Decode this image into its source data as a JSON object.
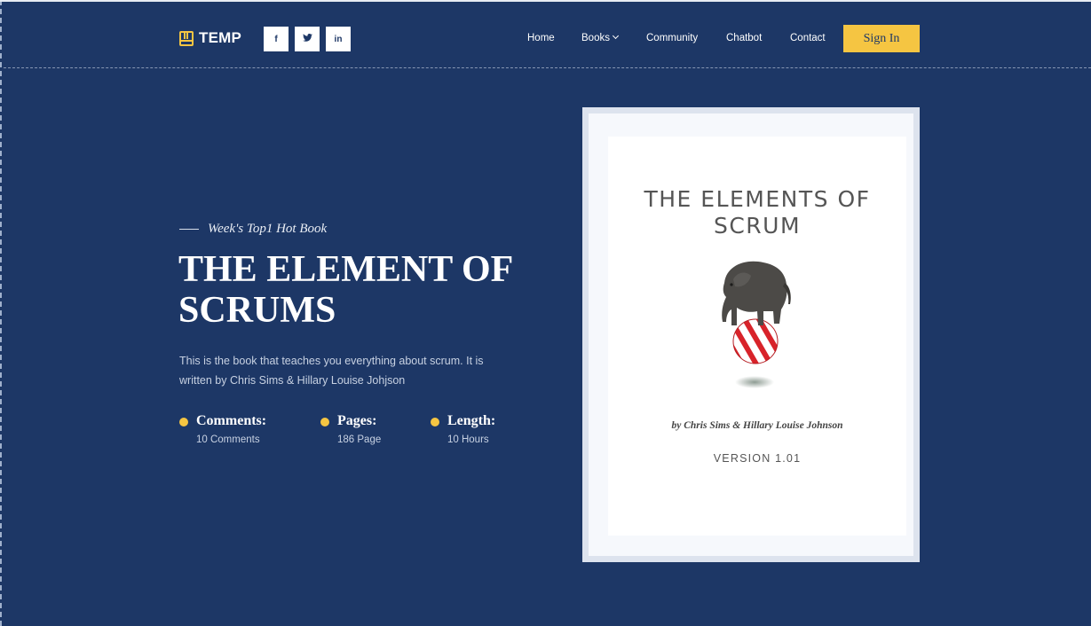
{
  "brand": {
    "name": "TEMP"
  },
  "social": [
    {
      "label": "f",
      "icon": "facebook-icon"
    },
    {
      "label": "t",
      "icon": "twitter-icon"
    },
    {
      "label": "in",
      "icon": "linkedin-icon"
    }
  ],
  "nav": {
    "home": "Home",
    "books": "Books",
    "community": "Community",
    "chatbot": "Chatbot",
    "contact": "Contact",
    "signin": "Sign In"
  },
  "hero": {
    "tagline": "Week's Top1 Hot Book",
    "title": "THE ELEMENT OF SCRUMS",
    "description": "This is the book that teaches you everything about scrum. It is written by Chris Sims & Hillary Louise Johjson",
    "stats": [
      {
        "label": "Comments:",
        "value": "10 Comments"
      },
      {
        "label": "Pages:",
        "value": "186 Page"
      },
      {
        "label": "Length:",
        "value": "10 Hours"
      }
    ]
  },
  "book": {
    "cover_title": "THE ELEMENTS OF SCRUM",
    "author": "by Chris Sims & Hillary Louise Johnson",
    "version": "VERSION 1.01"
  },
  "colors": {
    "background": "#1d3766",
    "accent": "#f5c542",
    "text": "#ffffff",
    "muted_text": "#c7d1e2"
  }
}
